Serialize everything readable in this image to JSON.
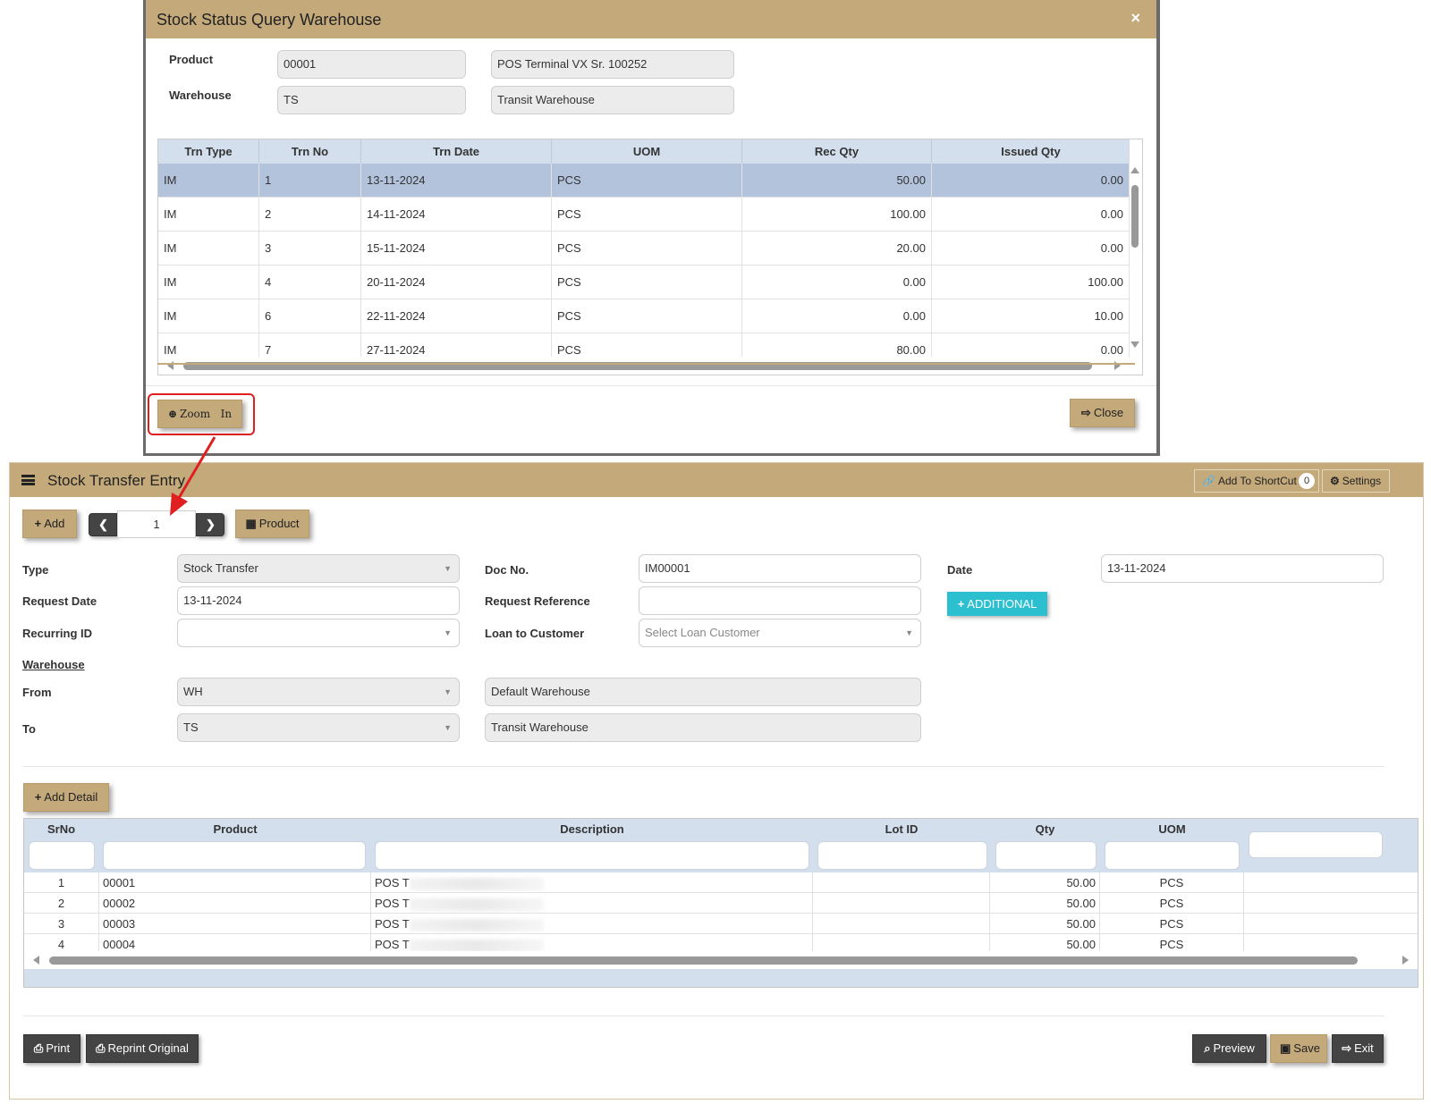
{
  "modal": {
    "title": "Stock Status Query Warehouse",
    "close_x": "×",
    "product_label": "Product",
    "product_code": "00001",
    "product_name": "POS Terminal VX Sr. 100252",
    "warehouse_label": "Warehouse",
    "warehouse_code": "TS",
    "warehouse_name": "Transit Warehouse",
    "grid": {
      "columns": [
        "Trn Type",
        "Trn No",
        "Trn Date",
        "UOM",
        "Rec Qty",
        "Issued Qty"
      ],
      "rows": [
        {
          "type": "IM",
          "no": "1",
          "date": "13-11-2024",
          "uom": "PCS",
          "rec": "50.00",
          "issued": "0.00"
        },
        {
          "type": "IM",
          "no": "2",
          "date": "14-11-2024",
          "uom": "PCS",
          "rec": "100.00",
          "issued": "0.00"
        },
        {
          "type": "IM",
          "no": "3",
          "date": "15-11-2024",
          "uom": "PCS",
          "rec": "20.00",
          "issued": "0.00"
        },
        {
          "type": "IM",
          "no": "4",
          "date": "20-11-2024",
          "uom": "PCS",
          "rec": "0.00",
          "issued": "100.00"
        },
        {
          "type": "IM",
          "no": "6",
          "date": "22-11-2024",
          "uom": "PCS",
          "rec": "0.00",
          "issued": "10.00"
        },
        {
          "type": "IM",
          "no": "7",
          "date": "27-11-2024",
          "uom": "PCS",
          "rec": "80.00",
          "issued": "0.00"
        }
      ]
    },
    "zoom_label": "Zoom   In",
    "close_label": "Close"
  },
  "main": {
    "title": "Stock Transfer Entry",
    "shortcut_label": "Add To ShortCut",
    "shortcut_count": "0",
    "settings_label": "Settings",
    "add_label": "Add",
    "nav_value": "1",
    "product_label": "Product",
    "type_label": "Type",
    "type_value": "Stock Transfer",
    "docno_label": "Doc No.",
    "docno_value": "IM00001",
    "date_label": "Date",
    "date_value": "13-11-2024",
    "request_date_label": "Request Date",
    "request_date_value": "13-11-2024",
    "request_ref_label": "Request Reference",
    "request_ref_value": "",
    "additional_label": "ADDITIONAL",
    "recurring_label": "Recurring ID",
    "recurring_value": "",
    "loan_label": "Loan to Customer",
    "loan_placeholder": "Select Loan Customer",
    "warehouse_section": "Warehouse",
    "from_label": "From",
    "from_code": "WH",
    "from_name": "Default Warehouse",
    "to_label": "To",
    "to_code": "TS",
    "to_name": "Transit Warehouse",
    "add_detail_label": "Add Detail",
    "detail": {
      "columns": [
        "SrNo",
        "Product",
        "Description",
        "Lot ID",
        "Qty",
        "UOM"
      ],
      "rows": [
        {
          "sr": "1",
          "product": "00001",
          "desc": "POS T",
          "lot": "",
          "qty": "50.00",
          "uom": "PCS"
        },
        {
          "sr": "2",
          "product": "00002",
          "desc": "POS T",
          "lot": "",
          "qty": "50.00",
          "uom": "PCS"
        },
        {
          "sr": "3",
          "product": "00003",
          "desc": "POS T",
          "lot": "",
          "qty": "50.00",
          "uom": "PCS"
        },
        {
          "sr": "4",
          "product": "00004",
          "desc": "POS T",
          "lot": "",
          "qty": "50.00",
          "uom": "PCS"
        }
      ]
    },
    "print_label": "Print",
    "reprint_label": "Reprint Original",
    "preview_label": "Preview",
    "save_label": "Save",
    "exit_label": "Exit"
  },
  "colors": {
    "gold": "#c4a97b",
    "selected_row": "#b3c3dc",
    "grid_header": "#d3dfec",
    "additional": "#2bbfd0",
    "annotation_red": "#e02020"
  },
  "icons": [
    "close-icon",
    "zoom-in-icon",
    "sign-out-icon",
    "hamburger-icon",
    "link-icon",
    "gear-icon",
    "plus-icon",
    "chevron-left-icon",
    "chevron-right-icon",
    "grid-icon",
    "print-icon",
    "search-icon",
    "save-icon"
  ]
}
